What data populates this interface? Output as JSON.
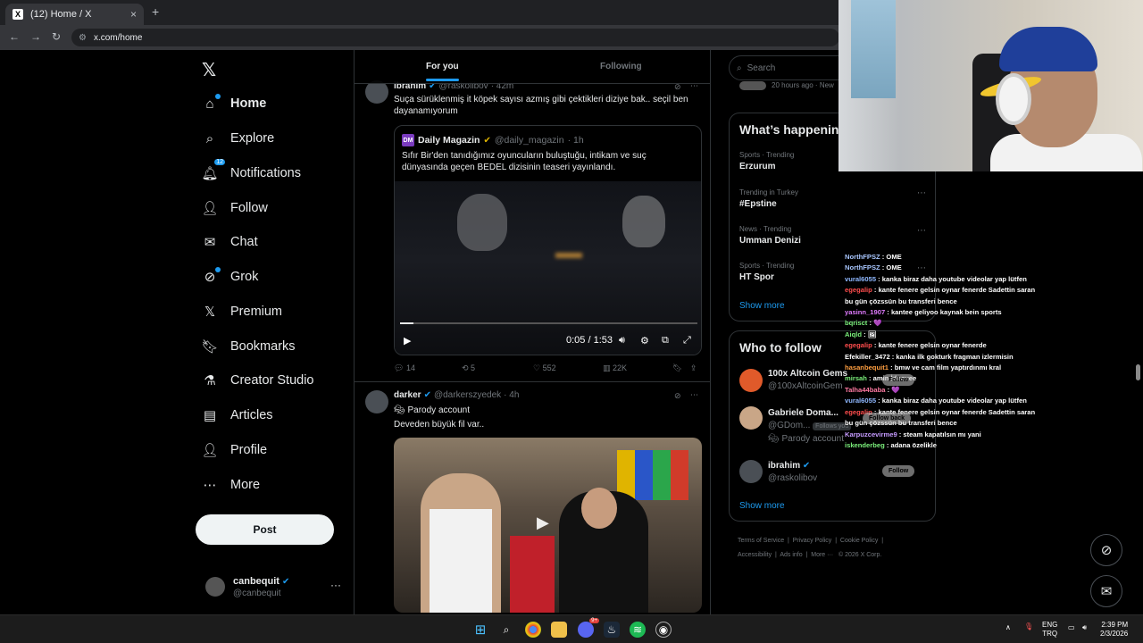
{
  "browser": {
    "tab_title": "(12) Home / X",
    "tab_fav": "X",
    "tab_close": "×",
    "new_tab": "+",
    "back": "←",
    "forward": "→",
    "reload": "↻",
    "url": "x.com/home"
  },
  "sidebar": {
    "logo": "𝕏",
    "items": [
      {
        "label": "Home",
        "icon": "home-icon"
      },
      {
        "label": "Explore",
        "icon": "search-icon"
      },
      {
        "label": "Notifications",
        "icon": "bell-icon",
        "badge": "12"
      },
      {
        "label": "Follow",
        "icon": "add-person-icon"
      },
      {
        "label": "Chat",
        "icon": "mail-icon"
      },
      {
        "label": "Grok",
        "icon": "grok-icon"
      },
      {
        "label": "Premium",
        "icon": "x-icon"
      },
      {
        "label": "Bookmarks",
        "icon": "bookmark-icon"
      },
      {
        "label": "Creator Studio",
        "icon": "flask-icon"
      },
      {
        "label": "Articles",
        "icon": "article-icon"
      },
      {
        "label": "Profile",
        "icon": "person-icon"
      },
      {
        "label": "More",
        "icon": "more-icon"
      }
    ],
    "post_label": "Post",
    "account": {
      "name": "canbequit",
      "handle": "@canbequit",
      "menu": "···"
    }
  },
  "feed": {
    "tabs": [
      "For you",
      "Following"
    ],
    "tweet1": {
      "name": "ibrahim",
      "handle": "@raskolibov",
      "time": "· 42m",
      "text": "Suça sürüklenmiş it köpek sayısı azmış gibi çektikleri diziye bak.. seçil ben dayanamıyorum",
      "quote": {
        "icon_text": "DM",
        "name": "Daily Magazin",
        "handle": "@daily_magazin",
        "time": "· 1h",
        "text": "Sıfır Bir'den tanıdığımız oyuncuların buluştuğu, intikam ve suç dünyasında geçen BEDEL dizisinin teaseri yayınlandı.",
        "video_time": "0:05 / 1:53",
        "progress": 0.046
      },
      "replies": "14",
      "reposts": "5",
      "likes": "552",
      "views": "22K"
    },
    "tweet2": {
      "name": "darker",
      "handle": "@darkerszyedek",
      "time": "· 4h",
      "parody": "Parody account",
      "text": "Deveden büyük fil var.."
    }
  },
  "right": {
    "search_placeholder": "Search",
    "peek_time": "20 hours ago · New",
    "happening_title": "What’s happening",
    "trends": [
      {
        "meta": "Sports · Trending",
        "name": "Erzurum"
      },
      {
        "meta": "Trending in Turkey",
        "name": "#Epstine"
      },
      {
        "meta": "News · Trending",
        "name": "Umman Denizi"
      },
      {
        "meta": "Sports · Trending",
        "name": "HT Spor"
      }
    ],
    "show_more": "Show more",
    "wtf_title": "Who to follow",
    "follows": [
      {
        "name": "100x Altcoin Gems",
        "handle": "@100xAltcoinGem"
      },
      {
        "name": "Gabriele Doma...",
        "handle": "@GDom...",
        "note": "Follows you",
        "parody": "Parody account"
      },
      {
        "name": "ibrahim",
        "handle": "@raskolibov"
      }
    ],
    "footer": [
      "Terms of Service",
      "Privacy Policy",
      "Cookie Policy",
      "Accessibility",
      "Ads info",
      "More ···",
      "© 2026 X Corp."
    ]
  },
  "chat": [
    {
      "user": "NorthFPSZ",
      "msg": "OME",
      "color": "#a9c7ff"
    },
    {
      "user": "NorthFPSZ",
      "msg": "OME",
      "color": "#a9c7ff"
    },
    {
      "user": "vural6055",
      "msg": "kanka biraz daha youtube videolar yap lütfen",
      "color": "#8fb8ff"
    },
    {
      "user": "egegalip",
      "msg": "kante fenere gelsin oynar fenerde Sadettin saran bu gün çözssün bu transferi bence",
      "color": "#ff4d4d"
    },
    {
      "user": "yasinn_1907",
      "msg": "kantee geliyoo kaynak bein sports",
      "color": "#e07bff"
    },
    {
      "user": "bqrisct",
      "msg": "💜",
      "color": "#7cf07c"
    },
    {
      "user": "Aiqld",
      "msg": "🖼",
      "color": "#7cf07c"
    },
    {
      "user": "egegalip",
      "msg": "kante fenere gelsin oynar fenerde",
      "color": "#ff4d4d"
    },
    {
      "user": "Efekiller_3472",
      "msg": "kanka ilk gokturk fragman izlermisin",
      "color": "#ffffff"
    },
    {
      "user": "hasanbequit1",
      "msg": "bmw ve cam film yaptırdınmı kral",
      "color": "#ff9f40"
    },
    {
      "user": "mirsah",
      "msg": "amin İdoovee",
      "color": "#7cf07c"
    },
    {
      "user": "Talha44baba",
      "msg": "💜",
      "color": "#ff7aa2"
    },
    {
      "user": "vural6055",
      "msg": "kanka biraz daha youtube videolar yap lütfen",
      "color": "#8fb8ff"
    },
    {
      "user": "egegalip",
      "msg": "kante fenere gelsin oynar fenerde Sadettin saran bu gün çözssün bu transferi bence",
      "color": "#ff4d4d"
    },
    {
      "user": "Karpuzcevirme9",
      "msg": "steam kapatılsın mı yani",
      "color": "#c69bff"
    },
    {
      "user": "iskenderbeg",
      "msg": "adana özelikle",
      "color": "#7cf07c"
    }
  ],
  "overlay_buttons": [
    "Follow",
    "Follow back",
    "Follow"
  ],
  "taskbar": {
    "lang": "ENG",
    "region": "TRQ",
    "time": "2:39 PM",
    "date": "2/3/2026",
    "discord_badge": "9+"
  }
}
